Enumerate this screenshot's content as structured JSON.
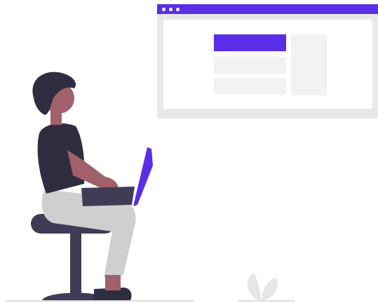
{
  "colors": {
    "accent": "#5a2de8",
    "window_frame": "#e8e8e8",
    "placeholder": "#f2f2f2",
    "stool": "#3f3d56",
    "shirt": "#2f2e41",
    "skin": "#a0616a",
    "hair": "#2f2e41",
    "pants": "#cfcfcf",
    "ground_line": "#d0d0d0",
    "plant": "#e6e6e6"
  },
  "illustration": {
    "subject_icon": "person-with-laptop-on-stool",
    "window_controls": [
      "dot",
      "dot",
      "dot"
    ]
  }
}
